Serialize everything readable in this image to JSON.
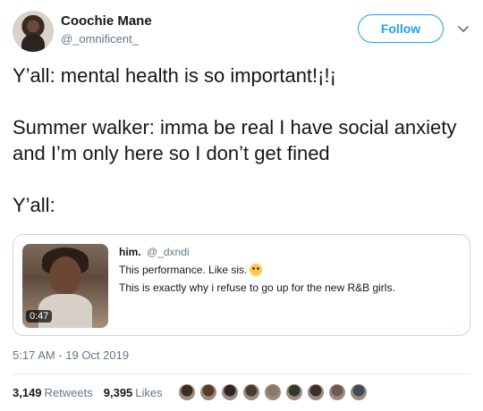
{
  "author": {
    "name": "Coochie Mane",
    "handle": "@_omnificent_"
  },
  "follow_label": "Follow",
  "tweet": {
    "lines": [
      "Y’all: mental health is so important!¡!¡",
      "Summer walker: imma be real I have social anxiety and I’m only here so I don’t get fined",
      "Y’all:"
    ]
  },
  "quote": {
    "name": "him.",
    "handle": "@_dxndi",
    "line1": "This performance. Like sis.",
    "line2": "This is exactly why i refuse to go up for the new R&B girls.",
    "duration": "0:47"
  },
  "timestamp": "5:17 AM - 19 Oct 2019",
  "stats": {
    "retweets_count": "3,149",
    "retweets_label": "Retweets",
    "likes_count": "9,395",
    "likes_label": "Likes"
  },
  "icons": {
    "chevron": "chevron-down-icon",
    "emoji": "face-with-rolling-eyes-emoji"
  },
  "colors": {
    "accent": "#1da1f2",
    "text_secondary": "#657786"
  },
  "liker_colors": [
    "#3b2a25",
    "#5a3b2a",
    "#2f2623",
    "#4a3a33",
    "#8a7a6e",
    "#2e3b28",
    "#3a2f2a",
    "#6e5a4e",
    "#3f4a55"
  ]
}
